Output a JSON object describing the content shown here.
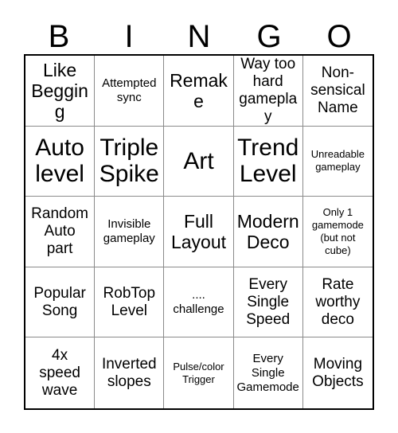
{
  "card": {
    "title": "BINGO",
    "header_letters": [
      "B",
      "I",
      "N",
      "G",
      "O"
    ],
    "grid_size": "5x5",
    "colors": {
      "text": "#000000",
      "background": "#ffffff",
      "outer_border": "#000000",
      "inner_gridline": "#8a8a8a"
    },
    "rows": [
      {
        "cells": [
          {
            "text": "Like\nBegging",
            "size": "lg"
          },
          {
            "text": "Attempted\nsync",
            "size": "sm"
          },
          {
            "text": "Remake",
            "size": "lg"
          },
          {
            "text": "Way too\nhard\ngameplay",
            "size": "md"
          },
          {
            "text": "Non-\nsensical\nName",
            "size": "md"
          }
        ]
      },
      {
        "cells": [
          {
            "text": "Auto\nlevel",
            "size": "xl"
          },
          {
            "text": "Triple\nSpike",
            "size": "xl"
          },
          {
            "text": "Art",
            "size": "xl"
          },
          {
            "text": "Trend\nLevel",
            "size": "xl"
          },
          {
            "text": "Unreadable\ngameplay",
            "size": "xs"
          }
        ]
      },
      {
        "cells": [
          {
            "text": "Random\nAuto\npart",
            "size": "md"
          },
          {
            "text": "Invisible\ngameplay",
            "size": "sm"
          },
          {
            "text": "Full\nLayout",
            "size": "lg"
          },
          {
            "text": "Modern\nDeco",
            "size": "lg"
          },
          {
            "text": "Only 1\ngamemode\n(but not\ncube)",
            "size": "xs"
          }
        ]
      },
      {
        "cells": [
          {
            "text": "Popular\nSong",
            "size": "md"
          },
          {
            "text": "RobTop\nLevel",
            "size": "md"
          },
          {
            "text": "....\nchallenge",
            "size": "sm"
          },
          {
            "text": "Every\nSingle\nSpeed",
            "size": "md"
          },
          {
            "text": "Rate\nworthy\ndeco",
            "size": "md"
          }
        ]
      },
      {
        "cells": [
          {
            "text": "4x\nspeed\nwave",
            "size": "md"
          },
          {
            "text": "Inverted\nslopes",
            "size": "md"
          },
          {
            "text": "Pulse/color\nTrigger",
            "size": "xs"
          },
          {
            "text": "Every\nSingle\nGamemode",
            "size": "sm"
          },
          {
            "text": "Moving\nObjects",
            "size": "md"
          }
        ]
      }
    ]
  }
}
